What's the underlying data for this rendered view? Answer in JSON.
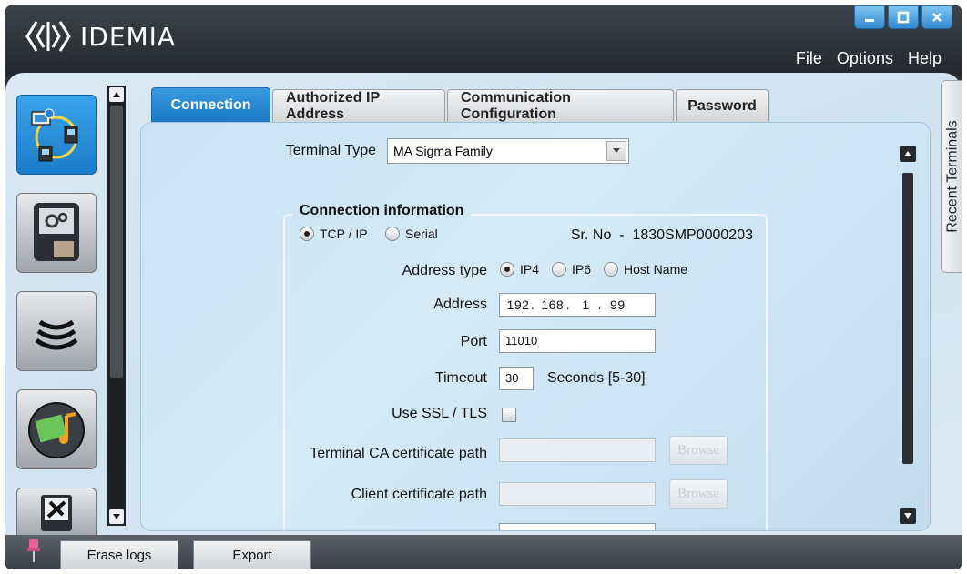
{
  "app": {
    "brand": "IDEMIA"
  },
  "menu": [
    "File",
    "Options",
    "Help"
  ],
  "tabs": [
    "Connection",
    "Authorized IP Address",
    "Communication Configuration",
    "Password"
  ],
  "active_tab": "Connection",
  "side_tab": "Recent Terminals",
  "form": {
    "terminal_type_label": "Terminal Type",
    "terminal_type_value": "MA Sigma Family",
    "group_title": "Connection information",
    "conn_tcp": "TCP / IP",
    "conn_serial": "Serial",
    "serial_no": "Sr. No  -  1830SMP0000203",
    "address_type_label": "Address type",
    "addr_ip4": "IP4",
    "addr_ip6": "IP6",
    "addr_host": "Host Name",
    "address_label": "Address",
    "address_octets": [
      "192",
      "168",
      "1",
      "99"
    ],
    "port_label": "Port",
    "port_value": "11010",
    "timeout_label": "Timeout",
    "timeout_value": "30",
    "timeout_hint": "Seconds [5-30]",
    "ssl_label": "Use SSL / TLS",
    "ca_label": "Terminal CA certificate path",
    "client_cert_label": "Client certificate path",
    "browse": "Browse"
  },
  "bottom": {
    "erase_logs": "Erase logs",
    "export": "Export"
  },
  "colors": {
    "accent": "#1c78c4",
    "header": "#2c3138",
    "panel": "#cfe2ef"
  }
}
